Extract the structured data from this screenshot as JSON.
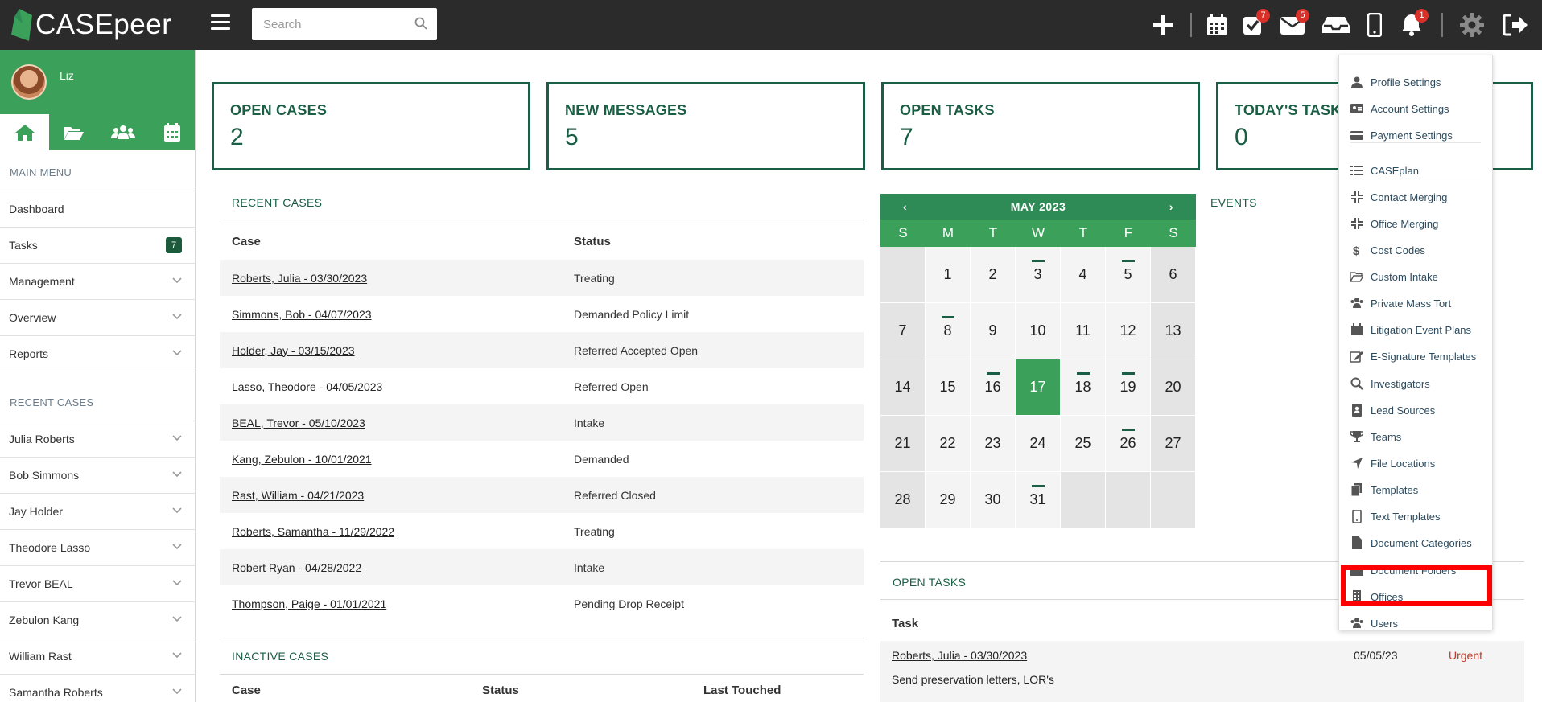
{
  "app": {
    "logo_text": "CASEpeer",
    "search_placeholder": "Search"
  },
  "topbar_badges": {
    "tasks": "7",
    "messages": "5",
    "notifications": "1"
  },
  "user": {
    "name": "Liz"
  },
  "sidebar": {
    "main_menu_heading": "MAIN MENU",
    "items": [
      {
        "label": "Dashboard"
      },
      {
        "label": "Tasks",
        "count": "7"
      },
      {
        "label": "Management"
      },
      {
        "label": "Overview"
      },
      {
        "label": "Reports"
      }
    ],
    "recent_heading": "RECENT CASES",
    "recent": [
      {
        "label": "Julia Roberts"
      },
      {
        "label": "Bob Simmons"
      },
      {
        "label": "Jay Holder"
      },
      {
        "label": "Theodore Lasso"
      },
      {
        "label": "Trevor BEAL"
      },
      {
        "label": "Zebulon Kang"
      },
      {
        "label": "William Rast"
      },
      {
        "label": "Samantha Roberts"
      }
    ]
  },
  "cards": [
    {
      "title": "OPEN CASES",
      "value": "2"
    },
    {
      "title": "NEW MESSAGES",
      "value": "5"
    },
    {
      "title": "OPEN TASKS",
      "value": "7"
    },
    {
      "title": "TODAY'S TASKS",
      "value": "0"
    }
  ],
  "recent_cases": {
    "title": "RECENT CASES",
    "col_case": "Case",
    "col_status": "Status",
    "rows": [
      {
        "case": "Roberts, Julia - 03/30/2023",
        "status": "Treating"
      },
      {
        "case": "Simmons, Bob - 04/07/2023",
        "status": "Demanded Policy Limit"
      },
      {
        "case": "Holder, Jay - 03/15/2023",
        "status": "Referred Accepted Open"
      },
      {
        "case": "Lasso, Theodore - 04/05/2023",
        "status": "Referred Open"
      },
      {
        "case": "BEAL, Trevor - 05/10/2023",
        "status": "Intake"
      },
      {
        "case": "Kang, Zebulon - 10/01/2021",
        "status": "Demanded"
      },
      {
        "case": "Rast, William - 04/21/2023",
        "status": "Referred Closed"
      },
      {
        "case": "Roberts, Samantha - 11/29/2022",
        "status": "Treating"
      },
      {
        "case": "Robert Ryan - 04/28/2022",
        "status": "Intake"
      },
      {
        "case": "Thompson, Paige - 01/01/2021",
        "status": "Pending Drop Receipt"
      }
    ]
  },
  "inactive_cases": {
    "title": "INACTIVE CASES",
    "col_case": "Case",
    "col_status": "Status",
    "col_touched": "Last Touched"
  },
  "calendar": {
    "month": "MAY 2023",
    "prev": "‹",
    "next": "›",
    "dow": [
      "S",
      "M",
      "T",
      "W",
      "T",
      "F",
      "S"
    ],
    "today": 17,
    "marked_days": [
      3,
      5,
      8,
      16,
      18,
      19,
      26,
      31
    ],
    "first_weekday": 1,
    "days_in_month": 31
  },
  "events": {
    "title": "EVENTS"
  },
  "open_tasks": {
    "title": "OPEN TASKS",
    "col_task": "Task",
    "rows": [
      {
        "case": "Roberts, Julia - 03/30/2023",
        "desc": "Send preservation letters, LOR's",
        "date": "05/05/23",
        "priority": "Urgent"
      }
    ]
  },
  "settings_menu": {
    "items": [
      {
        "label": "Profile Settings",
        "icon": "user-icon"
      },
      {
        "label": "Account Settings",
        "icon": "id-card-icon"
      },
      {
        "label": "Payment Settings",
        "icon": "credit-card-icon"
      },
      {
        "label": "CASEplan",
        "icon": "list-icon"
      },
      {
        "label": "Contact Merging",
        "icon": "compress-icon"
      },
      {
        "label": "Office Merging",
        "icon": "compress-icon"
      },
      {
        "label": "Cost Codes",
        "icon": "dollar-icon"
      },
      {
        "label": "Custom Intake",
        "icon": "folder-open-icon"
      },
      {
        "label": "Private Mass Tort",
        "icon": "users-icon"
      },
      {
        "label": "Litigation Event Plans",
        "icon": "calendar-icon"
      },
      {
        "label": "E-Signature Templates",
        "icon": "edit-icon"
      },
      {
        "label": "Investigators",
        "icon": "search-icon"
      },
      {
        "label": "Lead Sources",
        "icon": "address-book-icon"
      },
      {
        "label": "Teams",
        "icon": "trophy-icon"
      },
      {
        "label": "File Locations",
        "icon": "location-arrow-icon"
      },
      {
        "label": "Templates",
        "icon": "copy-icon"
      },
      {
        "label": "Text Templates",
        "icon": "mobile-icon"
      },
      {
        "label": "Document Categories",
        "icon": "file-icon"
      },
      {
        "label": "Document Folders",
        "icon": "folder-icon"
      },
      {
        "label": "Offices",
        "icon": "building-icon"
      },
      {
        "label": "Users",
        "icon": "users-icon"
      }
    ]
  },
  "colors": {
    "brand_green": "#3aa05a",
    "dark_green": "#1a5e45",
    "topbar": "#2b2b2b",
    "highlight": "#ff0000"
  }
}
